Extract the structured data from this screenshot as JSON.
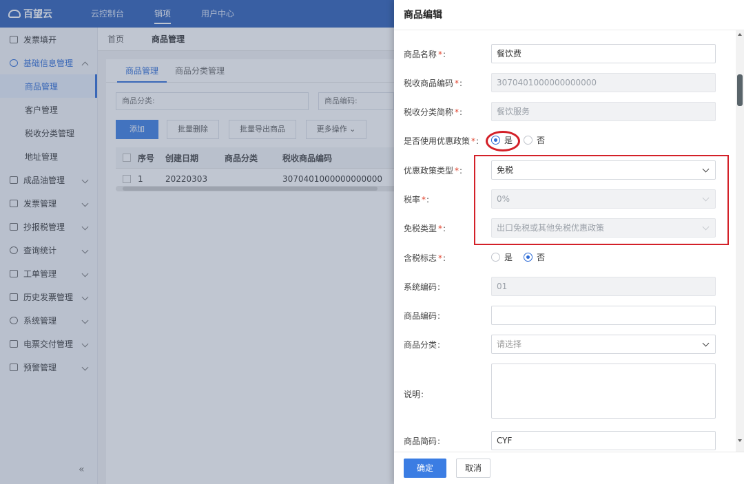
{
  "app": {
    "logo": "百望云"
  },
  "topnav": [
    "云控制台",
    "销项",
    "用户中心"
  ],
  "sidebar": {
    "items": [
      {
        "label": "发票填开"
      },
      {
        "label": "基础信息管理"
      },
      {
        "label": "商品管理"
      },
      {
        "label": "客户管理"
      },
      {
        "label": "税收分类管理"
      },
      {
        "label": "地址管理"
      },
      {
        "label": "成品油管理"
      },
      {
        "label": "发票管理"
      },
      {
        "label": "抄报税管理"
      },
      {
        "label": "查询统计"
      },
      {
        "label": "工单管理"
      },
      {
        "label": "历史发票管理"
      },
      {
        "label": "系统管理"
      },
      {
        "label": "电票交付管理"
      },
      {
        "label": "预警管理"
      }
    ],
    "collapse": "«"
  },
  "breadcrumb": {
    "home": "首页",
    "current": "商品管理"
  },
  "tabs": [
    "商品管理",
    "商品分类管理"
  ],
  "filters": {
    "category": "商品分类:",
    "code": "商品编码:"
  },
  "actions": {
    "add": "添加",
    "batch_delete": "批量删除",
    "batch_export": "批量导出商品",
    "more": "更多操作 ⌄"
  },
  "table": {
    "headers": [
      "序号",
      "创建日期",
      "商品分类",
      "税收商品编码"
    ],
    "rows": [
      [
        "1",
        "20220303",
        "",
        "3070401000000000000"
      ]
    ]
  },
  "drawer": {
    "title": "商品编辑",
    "fields": {
      "name": {
        "label": "商品名称",
        "value": "餐饮费"
      },
      "tax_code": {
        "label": "税收商品编码",
        "value": "3070401000000000000"
      },
      "tax_short": {
        "label": "税收分类简称",
        "value": "餐饮服务"
      },
      "use_policy": {
        "label": "是否使用优惠政策",
        "yes": "是",
        "no": "否"
      },
      "policy_type": {
        "label": "优惠政策类型",
        "value": "免税"
      },
      "tax_rate": {
        "label": "税率",
        "value": "0%"
      },
      "exempt_type": {
        "label": "免税类型",
        "value": "出口免税或其他免税优惠政策"
      },
      "tax_included": {
        "label": "含税标志",
        "yes": "是",
        "no": "否"
      },
      "sys_code": {
        "label": "系统编码",
        "value": "01"
      },
      "product_code": {
        "label": "商品编码",
        "value": ""
      },
      "category": {
        "label": "商品分类",
        "placeholder": "请选择"
      },
      "description": {
        "label": "说明",
        "value": ""
      },
      "short_code": {
        "label": "商品简码",
        "value": "CYF"
      }
    },
    "buttons": {
      "ok": "确定",
      "cancel": "取消"
    }
  },
  "colors": {
    "primary": "#3b7de3",
    "topbar": "#2d5eb8",
    "highlight": "#d32028"
  }
}
